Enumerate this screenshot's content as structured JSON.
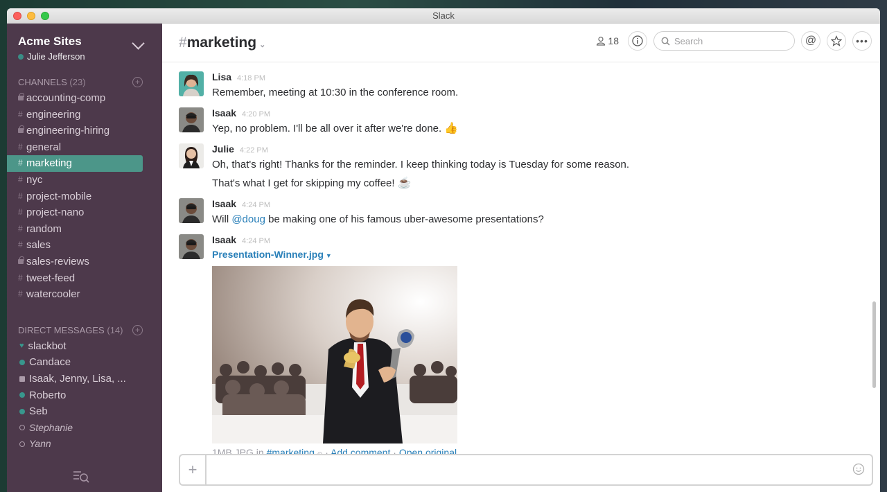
{
  "window": {
    "title": "Slack"
  },
  "team": {
    "name": "Acme Sites",
    "user": "Julie Jefferson"
  },
  "channels": {
    "heading": "CHANNELS",
    "count": "(23)",
    "items": [
      {
        "label": "accounting-comp",
        "private": true
      },
      {
        "label": "engineering",
        "private": false
      },
      {
        "label": "engineering-hiring",
        "private": true
      },
      {
        "label": "general",
        "private": false
      },
      {
        "label": "marketing",
        "private": false,
        "active": true
      },
      {
        "label": "nyc",
        "private": false
      },
      {
        "label": "project-mobile",
        "private": false
      },
      {
        "label": "project-nano",
        "private": false
      },
      {
        "label": "random",
        "private": false
      },
      {
        "label": "sales",
        "private": false
      },
      {
        "label": "sales-reviews",
        "private": true
      },
      {
        "label": "tweet-feed",
        "private": false
      },
      {
        "label": "watercooler",
        "private": false
      }
    ]
  },
  "direct_messages": {
    "heading": "DIRECT MESSAGES",
    "count": "(14)",
    "items": [
      {
        "label": "slackbot",
        "status": "heart"
      },
      {
        "label": "Candace",
        "status": "online"
      },
      {
        "label": "Isaak, Jenny, Lisa, ...",
        "status": "group"
      },
      {
        "label": "Roberto",
        "status": "online"
      },
      {
        "label": "Seb",
        "status": "online"
      },
      {
        "label": "Stephanie",
        "status": "away"
      },
      {
        "label": "Yann",
        "status": "away"
      }
    ]
  },
  "header": {
    "hash": "#",
    "channel_name": "marketing",
    "member_count": "18",
    "search_placeholder": "Search"
  },
  "messages": [
    {
      "sender": "Lisa",
      "time": "4:18 PM",
      "lines": [
        "Remember, meeting at 10:30 in the conference room."
      ]
    },
    {
      "sender": "Isaak",
      "time": "4:20 PM",
      "text": "Yep, no problem. I'll be all over it after we're done.",
      "emoji": "👍"
    },
    {
      "sender": "Julie",
      "time": "4:22 PM",
      "line1": "Oh, that's right! Thanks for the reminder. I keep thinking today is Tuesday for some reason.",
      "line2": "That's what I get for skipping my coffee!",
      "emoji": "☕"
    },
    {
      "sender": "Isaak",
      "time": "4:24 PM",
      "before": "Will ",
      "mention": "@doug",
      "after": " be making one of his famous uber-awesome presentations?"
    },
    {
      "sender": "Isaak",
      "time": "4:24 PM",
      "file_name": "Presentation-Winner.jpg",
      "file_info": "1MB JPG in ",
      "file_channel": "#marketing",
      "add_comment": "Add comment",
      "open_original": "Open original"
    }
  ],
  "colors": {
    "sidebar": "#4d394b",
    "active_channel": "#4c9689",
    "link": "#2a80b9",
    "presence": "#38978d"
  }
}
